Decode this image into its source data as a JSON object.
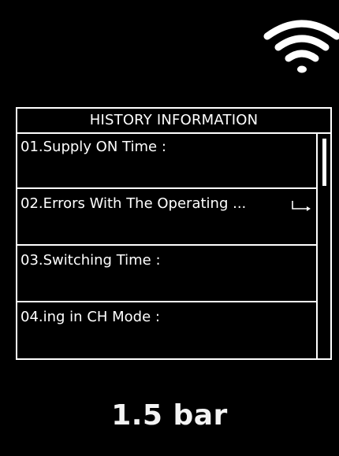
{
  "status": {
    "wifi_icon": "wifi-icon"
  },
  "history": {
    "title": "HISTORY INFORMATION",
    "items": [
      {
        "label": "01.Supply ON Time :"
      },
      {
        "label": "02.Errors With The Operating ...",
        "icon": "enter-arrow-icon"
      },
      {
        "label": "03.Switching Time :"
      },
      {
        "label": "04.ing in CH Mode :"
      }
    ]
  },
  "pressure": {
    "value": "1.5 bar"
  },
  "colors": {
    "background": "#000000",
    "foreground": "#ffffff"
  }
}
